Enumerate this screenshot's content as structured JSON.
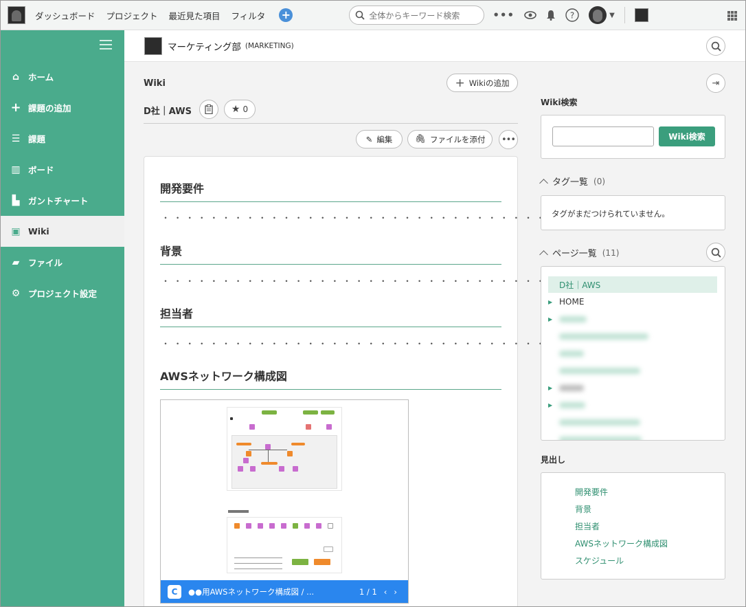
{
  "topbar": {
    "nav": [
      "ダッシュボード",
      "プロジェクト",
      "最近見た項目",
      "フィルタ"
    ],
    "search_placeholder": "全体からキーワード検索"
  },
  "sidebar": {
    "items": [
      {
        "label": "ホーム",
        "icon": "home-icon"
      },
      {
        "label": "課題の追加",
        "icon": "plus-icon"
      },
      {
        "label": "課題",
        "icon": "list-icon"
      },
      {
        "label": "ボード",
        "icon": "board-icon"
      },
      {
        "label": "ガントチャート",
        "icon": "gantt-icon"
      },
      {
        "label": "Wiki",
        "icon": "wiki-icon",
        "active": true
      },
      {
        "label": "ファイル",
        "icon": "folder-icon"
      },
      {
        "label": "プロジェクト設定",
        "icon": "gear-icon"
      }
    ]
  },
  "project": {
    "name": "マーケティング部",
    "key": "(MARKETING)"
  },
  "wiki": {
    "label": "Wiki",
    "add_button": "Wikiの追加",
    "page_title": "D社｜AWS",
    "star_count": "0",
    "edit_button": "編集",
    "attach_button": "ファイルを添付",
    "sections": [
      {
        "heading": "開発要件",
        "dots": "・・・・・・・・・・・・・・・・・・・・・・・・・・・・・・・・・・・・"
      },
      {
        "heading": "背景",
        "dots": "・・・・・・・・・・・・・・・・・・・・・・・・・・・・・・・・・・・・"
      },
      {
        "heading": "担当者",
        "dots": "・・・・・・・・・・・・・・・・・・・・・・・・・・・・・・・・・・・・"
      },
      {
        "heading": "AWSネットワーク構成図"
      }
    ],
    "embed": {
      "logo": "C",
      "caption": "●●用AWSネットワーク構成図 / ...",
      "page": "1 / 1"
    }
  },
  "right": {
    "wiki_search_label": "Wiki検索",
    "wiki_search_button": "Wiki検索",
    "tags_title": "タグ一覧",
    "tags_count": "(0)",
    "tags_empty": "タグがまだつけられていません。",
    "pages_title": "ページ一覧",
    "pages_count": "(11)",
    "pages": [
      "D社｜AWS",
      "HOME"
    ],
    "toc_label": "見出し",
    "toc": [
      "開発要件",
      "背景",
      "担当者",
      "AWSネットワーク構成図",
      "スケジュール"
    ]
  },
  "colors": {
    "sidebar": "#4aab8c",
    "accent": "#3b9e7d",
    "link": "#2f8f70",
    "embed_bar": "#2a86ee"
  }
}
